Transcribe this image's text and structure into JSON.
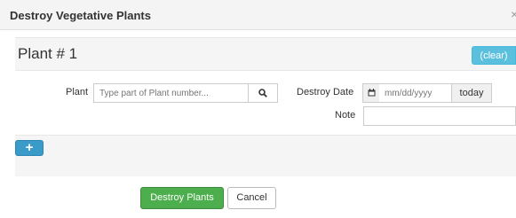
{
  "dialog": {
    "title": "Destroy Vegetative Plants",
    "close_glyph": "×"
  },
  "plant": {
    "heading": "Plant # 1",
    "clear_label": "(clear)",
    "plant_label": "Plant",
    "plant_placeholder": "Type part of Plant number...",
    "search_icon": "search-icon",
    "destroy_date_label": "Destroy Date",
    "calendar_icon": "calendar-icon",
    "date_placeholder": "mm/dd/yyyy",
    "today_label": "today",
    "note_label": "Note",
    "note_value": ""
  },
  "add_button_label": "+",
  "footer": {
    "destroy_label": "Destroy Plants",
    "cancel_label": "Cancel"
  },
  "colors": {
    "info": "#5bc0de",
    "primary": "#3a9bc9",
    "success": "#4cae4c"
  }
}
